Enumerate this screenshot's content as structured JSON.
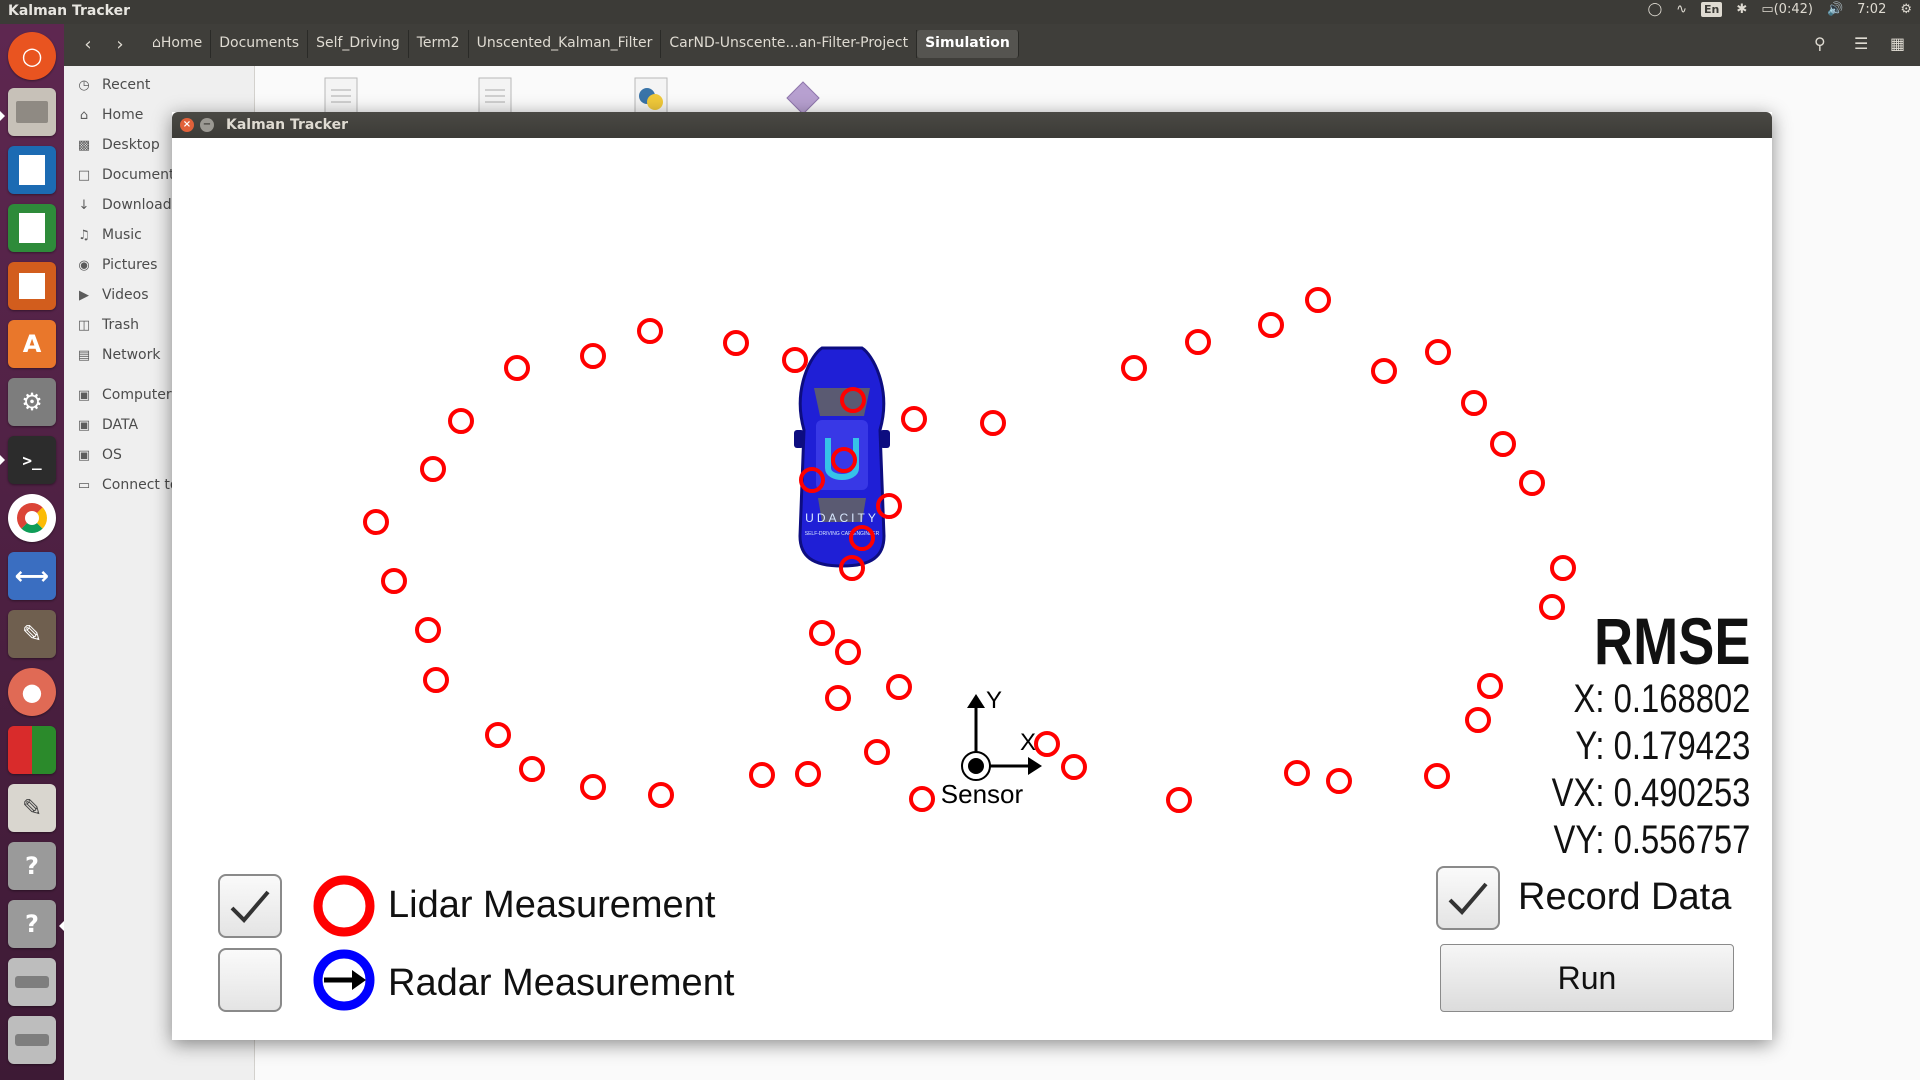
{
  "top_panel": {
    "window_title": "Kalman Tracker",
    "lang": "En",
    "battery": "(0:42)",
    "clock": "7:02"
  },
  "launcher": {
    "icons": [
      "ubuntu-dash-icon",
      "files-icon",
      "writer-icon",
      "calc-icon",
      "impress-icon",
      "software-center-icon",
      "system-settings-icon",
      "terminal-icon",
      "chrome-icon",
      "vscode-icon",
      "gimp-icon",
      "idea-icon",
      "app-grid-icon",
      "text-editor-icon",
      "unknown-app-icon",
      "unknown-app-icon",
      "drive-icon",
      "drive-icon"
    ]
  },
  "file_manager": {
    "breadcrumb": [
      "Home",
      "Documents",
      "Self_Driving",
      "Term2",
      "Unscented_Kalman_Filter",
      "CarND-Unscente...an-Filter-Project",
      "Simulation"
    ],
    "sidebar": [
      "Recent",
      "Home",
      "Desktop",
      "Document",
      "Download",
      "Music",
      "Pictures",
      "Videos",
      "Trash",
      "Network",
      "Computer",
      "DATA",
      "OS",
      "Connect to"
    ]
  },
  "sim_window": {
    "title": "Kalman Tracker",
    "car_text": "UDACITY",
    "car_subtext": "SELF-DRIVING CAR ENGINEER",
    "axis_x": "X",
    "axis_y": "Y",
    "sensor_label": "Sensor",
    "rmse": {
      "title": "RMSE",
      "x": "X: 0.168802",
      "y": "Y: 0.179423",
      "vx": "VX: 0.490253",
      "vy": "VY: 0.556757"
    },
    "lidar": {
      "label": "Lidar Measurement",
      "checked": true,
      "color": "#ff0000"
    },
    "radar": {
      "label": "Radar Measurement",
      "checked": false,
      "color": "#0000ff"
    },
    "record": {
      "label": "Record Data",
      "checked": true
    },
    "run_label": "Run"
  }
}
